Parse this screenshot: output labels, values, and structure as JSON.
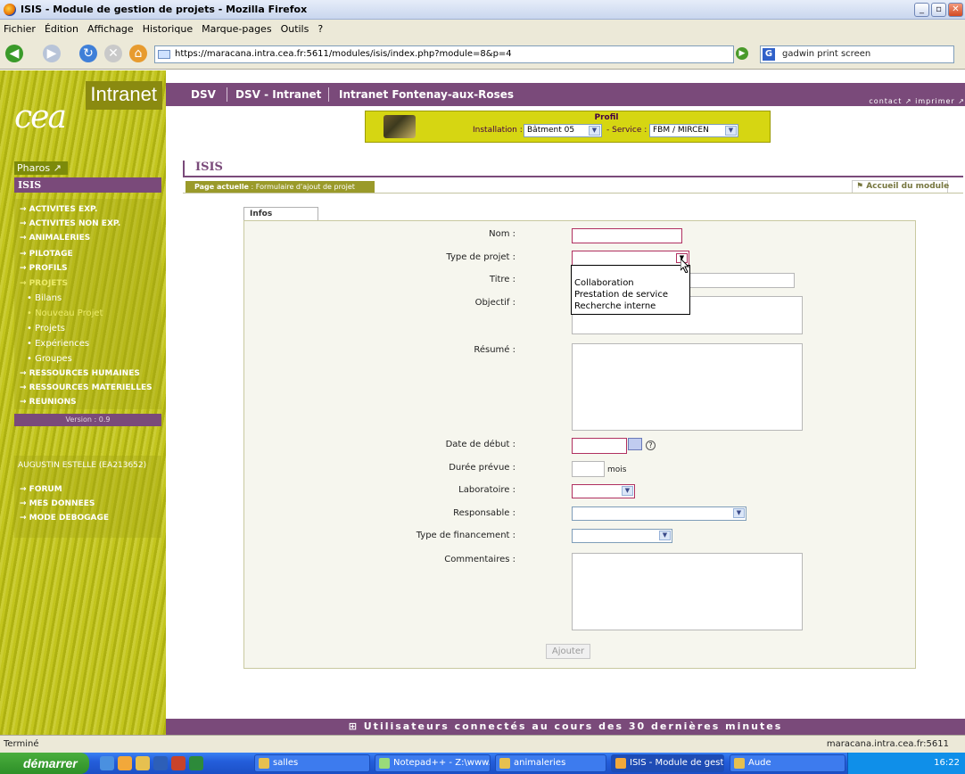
{
  "window": {
    "title": "ISIS - Module de gestion de projets - Mozilla Firefox"
  },
  "menu": [
    "Fichier",
    "Édition",
    "Affichage",
    "Historique",
    "Marque-pages",
    "Outils",
    "?"
  ],
  "nav": {
    "url": "https://maracana.intra.cea.fr:5611/modules/isis/index.php?module=8&p=4",
    "search": "gadwin print screen"
  },
  "brand": {
    "logo": "cea",
    "intranet": "Intranet",
    "pharos": "Pharos ↗",
    "isis": "ISIS"
  },
  "topbar": {
    "link1": "DSV",
    "link2": "DSV - Intranet",
    "link3": "Intranet Fontenay-aux-Roses",
    "contact": "contact ↗ imprimer ↗"
  },
  "profil": {
    "title": "Profil",
    "installation_label": "Installation :",
    "installation_value": "Bâtment 05",
    "service_label": "- Service :",
    "service_value": "FBM / MIRCEN"
  },
  "sidebar": {
    "items": [
      {
        "label": "→ ACTIVITES EXP."
      },
      {
        "label": "→ ACTIVITES NON EXP."
      },
      {
        "label": "→ ANIMALERIES"
      },
      {
        "label": "→ PILOTAGE"
      },
      {
        "label": "→ PROFILS"
      },
      {
        "label": "→ PROJETS"
      }
    ],
    "subitems": [
      {
        "label": "• Bilans"
      },
      {
        "label": "• Nouveau Projet"
      },
      {
        "label": "• Projets"
      },
      {
        "label": "• Expériences"
      },
      {
        "label": "• Groupes"
      }
    ],
    "items2": [
      {
        "label": "→ RESSOURCES HUMAINES"
      },
      {
        "label": "→ RESSOURCES MATERIELLES"
      },
      {
        "label": "→ REUNIONS"
      }
    ],
    "version": "Version : 0.9",
    "user": "AUGUSTIN ESTELLE (EA213652)",
    "user_items": [
      {
        "label": "→ FORUM"
      },
      {
        "label": "→ MES DONNEES"
      },
      {
        "label": "→ MODE DEBOGAGE"
      }
    ]
  },
  "main": {
    "title": "ISIS",
    "page_actuelle_label": "Page actuelle",
    "page_actuelle_value": " : Formulaire d'ajout de projet",
    "accueil": "⚑ Accueil du module",
    "tab": "Infos générales",
    "labels": {
      "nom": "Nom :",
      "type": "Type de projet :",
      "titre": "Titre :",
      "objectif": "Objectif :",
      "resume": "Résumé :",
      "date": "Date de début :",
      "duree": "Durée prévue :",
      "mois": "mois",
      "labo": "Laboratoire :",
      "resp": "Responsable :",
      "finance": "Type de financement :",
      "comment": "Commentaires :"
    },
    "type_options": [
      "Collaboration",
      "Prestation de service",
      "Recherche interne"
    ],
    "submit": "Ajouter"
  },
  "footer": "⊞ Utilisateurs connectés au cours des 30 dernières minutes",
  "status": {
    "left": "Terminé",
    "right": "maracana.intra.cea.fr:5611"
  },
  "taskbar": {
    "start": "démarrer",
    "tasks": [
      "salles",
      "Notepad++ - Z:\\www...",
      "animaleries",
      "ISIS - Module de gest...",
      "Aude"
    ],
    "clock": "16:22"
  }
}
